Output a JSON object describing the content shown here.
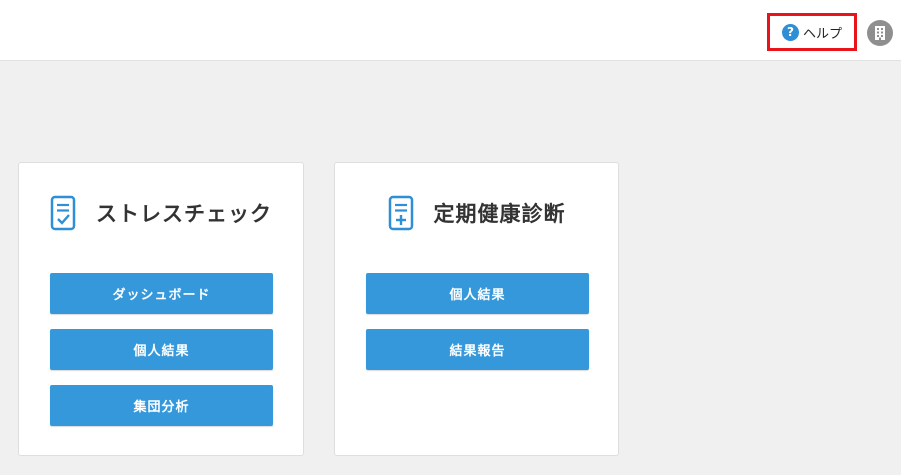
{
  "header": {
    "help_label": "ヘルプ",
    "help_icon": "question-circle-icon",
    "company_icon": "building-icon",
    "highlight_color": "#e8141a"
  },
  "cards": [
    {
      "title": "ストレスチェック",
      "icon": "clipboard-check-icon",
      "buttons": [
        "ダッシュボード",
        "個人結果",
        "集団分析"
      ]
    },
    {
      "title": "定期健康診断",
      "icon": "clipboard-plus-icon",
      "buttons": [
        "個人結果",
        "結果報告"
      ]
    }
  ],
  "colors": {
    "button_bg": "#3598db",
    "icon_blue": "#2f8fd6",
    "page_bg": "#f0f0f0"
  }
}
